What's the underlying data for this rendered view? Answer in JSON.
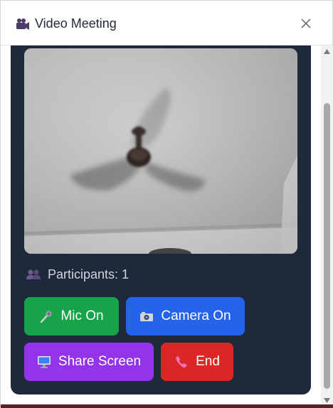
{
  "header": {
    "title": "Video Meeting",
    "title_icon": "video-camera-icon",
    "close_icon": "close-icon"
  },
  "video": {
    "description_icon": "camera-feed"
  },
  "participants": {
    "label": "Participants: 1",
    "icon": "people-icon"
  },
  "controls": {
    "mic_label": "Mic On",
    "camera_label": "Camera On",
    "share_label": "Share Screen",
    "end_label": "End"
  },
  "colors": {
    "panel_bg": "#1e293b",
    "mic": "#16a34a",
    "camera": "#2563eb",
    "share": "#9333ea",
    "end": "#dc2626"
  }
}
